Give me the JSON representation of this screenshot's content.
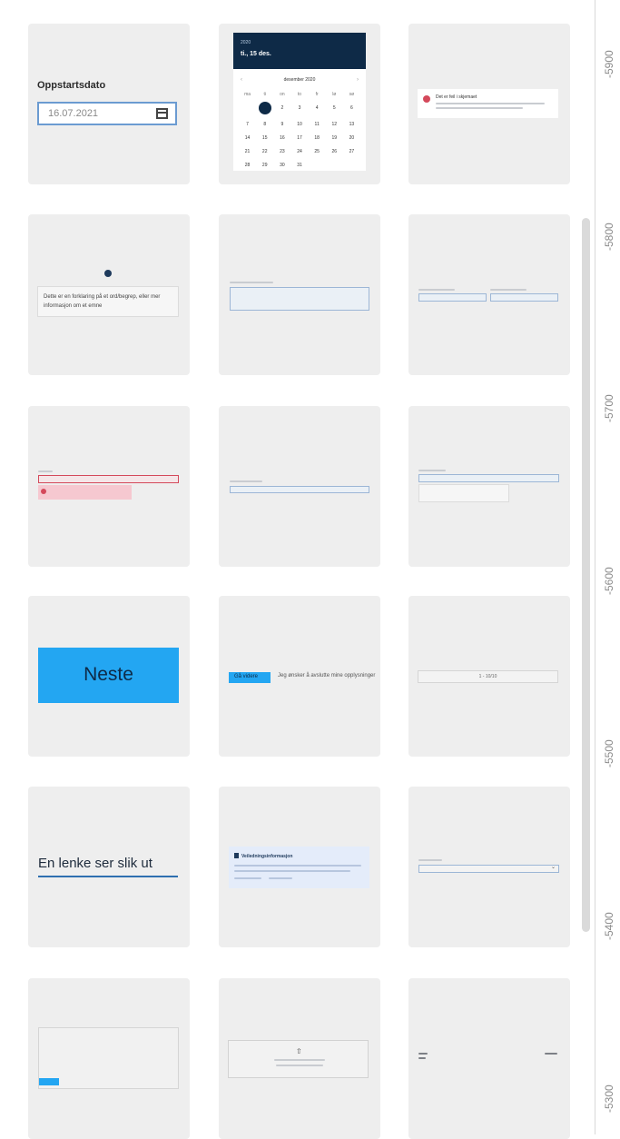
{
  "ruler": {
    "labels": [
      "-5900",
      "-5800",
      "-5700",
      "-5600",
      "-5500",
      "-5400",
      "-5300"
    ]
  },
  "cards": {
    "date_field": {
      "label": "Oppstartsdato",
      "value": "16.07.2021",
      "icon": "calendar-icon"
    },
    "datepicker": {
      "small": "2020",
      "big": "ti., 15 des.",
      "month": "desember 2020",
      "weekdays": [
        "ma",
        "ti",
        "on",
        "to",
        "fr",
        "lø",
        "sø"
      ],
      "days": [
        "",
        "1",
        "2",
        "3",
        "4",
        "5",
        "6",
        "7",
        "8",
        "9",
        "10",
        "11",
        "12",
        "13",
        "14",
        "15",
        "16",
        "17",
        "18",
        "19",
        "20",
        "21",
        "22",
        "23",
        "24",
        "25",
        "26",
        "27",
        "28",
        "29",
        "30",
        "31"
      ],
      "selected": "1"
    },
    "error_summary": {
      "title": "Det er feil i skjemaet"
    },
    "tooltip": {
      "text": "Dette er en forklaring på et ord/begrep, eller mer informasjon om et emne"
    },
    "primary_button": {
      "label": "Neste"
    },
    "button_row": {
      "button": "Gå videre",
      "link": "Jeg ønsker å avslutte mine opplysninger"
    },
    "pagination": {
      "label": "1 - 10/10"
    },
    "link": {
      "text": "En lenke ser slik ut"
    },
    "info_panel": {
      "title": "Veiledningsinformasjon"
    },
    "upload": {
      "icon": "upload-icon"
    }
  },
  "colors": {
    "card_bg": "#eeeeee",
    "primary": "#23a6f2",
    "navy": "#0e2a47",
    "error": "#d4495b",
    "link_underline": "#2e6fb0"
  }
}
